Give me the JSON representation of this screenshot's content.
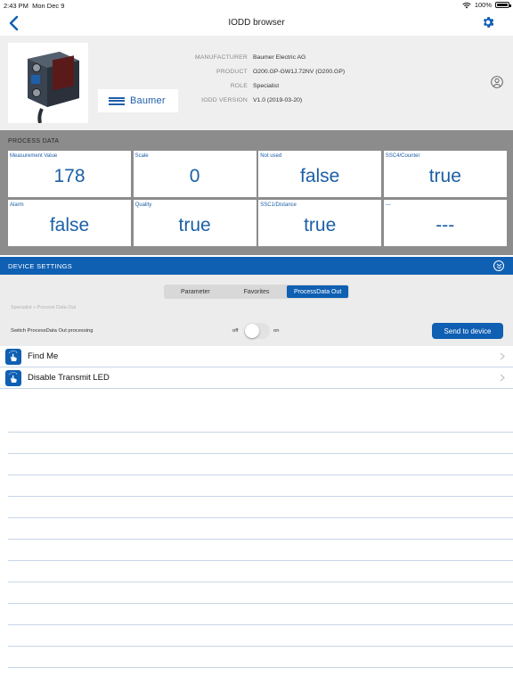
{
  "status_bar": {
    "time": "2:43 PM",
    "date": "Mon Dec 9",
    "battery_text": "100%",
    "battery_level": 1.0
  },
  "nav": {
    "title": "IODD browser",
    "back_icon": "chevron-left-icon",
    "settings_icon": "gear-icon"
  },
  "device": {
    "brand": "Baumer",
    "rows": [
      {
        "label": "MANUFACTURER",
        "value": "Baumer Electric AG"
      },
      {
        "label": "PRODUCT",
        "value": "O200.GP-GW1J.72NV (O200.GP)"
      },
      {
        "label": "ROLE",
        "value": "Specialist"
      },
      {
        "label": "IODD VERSION",
        "value": "V1.0 (2019-03-20)"
      }
    ]
  },
  "process_data": {
    "title": "PROCESS DATA",
    "cells": [
      {
        "label": "Measurement Value",
        "value": "178"
      },
      {
        "label": "Scale",
        "value": "0"
      },
      {
        "label": "Not used",
        "value": "false"
      },
      {
        "label": "SSC4/Counter",
        "value": "true"
      },
      {
        "label": "Alarm",
        "value": "false"
      },
      {
        "label": "Quality",
        "value": "true"
      },
      {
        "label": "SSC1/Distance",
        "value": "true"
      },
      {
        "label": "---",
        "value": "---"
      }
    ]
  },
  "device_settings": {
    "title": "DEVICE SETTINGS",
    "tabs": [
      {
        "label": "Parameter",
        "active": false
      },
      {
        "label": "Favorites",
        "active": false
      },
      {
        "label": "ProcessData Out",
        "active": true
      }
    ],
    "breadcrumb": "Specialist » Process Data Out",
    "switch_label": "Switch ProcessData Out processing",
    "toggle_off": "off",
    "toggle_on": "on",
    "toggle_state": false,
    "send_button": "Send to device"
  },
  "actions": [
    {
      "label": "Find Me",
      "icon": "hand-tap-icon"
    },
    {
      "label": "Disable Transmit LED",
      "icon": "hand-tap-icon"
    }
  ],
  "colors": {
    "accent": "#0f5fb3",
    "header_bg": "#efefef",
    "process_bg": "#8c8c8c",
    "value_text": "#1c5fa6"
  }
}
